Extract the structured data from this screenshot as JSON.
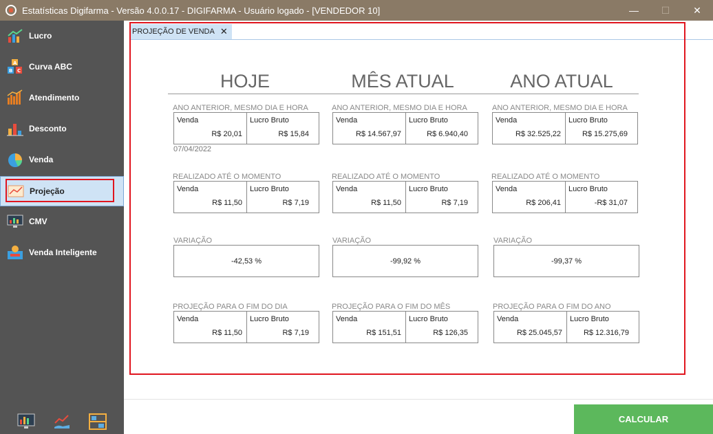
{
  "window": {
    "title": "Estatísticas Digifarma - Versão 4.0.0.17 - DIGIFARMA -  Usuário logado - [VENDEDOR 10]",
    "minimize": "—",
    "maximize": "☐",
    "close": "✕"
  },
  "sidebar": {
    "items": [
      {
        "label": "Lucro",
        "icon": "profit-chart-icon"
      },
      {
        "label": "Curva ABC",
        "icon": "abc-blocks-icon"
      },
      {
        "label": "Atendimento",
        "icon": "bar-chart-icon"
      },
      {
        "label": "Desconto",
        "icon": "discount-chart-icon"
      },
      {
        "label": "Venda",
        "icon": "pie-chart-icon"
      },
      {
        "label": "Projeção",
        "icon": "projection-chart-icon"
      },
      {
        "label": "CMV",
        "icon": "monitor-chart-icon"
      },
      {
        "label": "Venda Inteligente",
        "icon": "smart-sale-icon"
      }
    ],
    "active_index": 5
  },
  "tab": {
    "label": "PROJEÇÃO DE VENDA",
    "close": "✕"
  },
  "columns": [
    {
      "title": "HOJE",
      "prev_label": "ANO ANTERIOR, MESMO DIA E HORA",
      "prev": {
        "venda_label": "Venda",
        "venda": "R$ 20,01",
        "lucro_label": "Lucro Bruto",
        "lucro": "R$ 15,84"
      },
      "date": "07/04/2022",
      "real_label": "REALIZADO ATÉ O MOMENTO",
      "real": {
        "venda_label": "Venda",
        "venda": "R$ 11,50",
        "lucro_label": "Lucro Bruto",
        "lucro": "R$ 7,19"
      },
      "var_label": "VARIAÇÃO",
      "variacao": "-42,53 %",
      "proj_label": "PROJEÇÃO PARA O FIM DO DIA",
      "proj": {
        "venda_label": "Venda",
        "venda": "R$ 11,50",
        "lucro_label": "Lucro Bruto",
        "lucro": "R$ 7,19"
      }
    },
    {
      "title": "MÊS ATUAL",
      "prev_label": "ANO ANTERIOR, MESMO DIA E HORA",
      "prev": {
        "venda_label": "Venda",
        "venda": "R$ 14.567,97",
        "lucro_label": "Lucro Bruto",
        "lucro": "R$ 6.940,40"
      },
      "real_label": "REALIZADO ATÉ O MOMENTO",
      "real": {
        "venda_label": "Venda",
        "venda": "R$ 11,50",
        "lucro_label": "Lucro Bruto",
        "lucro": "R$ 7,19"
      },
      "var_label": "VARIAÇÃO",
      "variacao": "-99,92 %",
      "proj_label": "PROJEÇÃO PARA O FIM DO MÊS",
      "proj": {
        "venda_label": "Venda",
        "venda": "R$ 151,51",
        "lucro_label": "Lucro Bruto",
        "lucro": "R$ 126,35"
      }
    },
    {
      "title": "ANO ATUAL",
      "prev_label": "ANO ANTERIOR, MESMO DIA E HORA",
      "prev": {
        "venda_label": "Venda",
        "venda": "R$ 32.525,22",
        "lucro_label": "Lucro Bruto",
        "lucro": "R$ 15.275,69"
      },
      "real_label": "REALIZADO ATÉ O MOMENTO",
      "real": {
        "venda_label": "Venda",
        "venda": "R$ 206,41",
        "lucro_label": "Lucro Bruto",
        "lucro": "-R$ 31,07"
      },
      "var_label": "VARIAÇÃO",
      "variacao": "-99,37 %",
      "proj_label": "PROJEÇÃO PARA O FIM DO ANO",
      "proj": {
        "venda_label": "Venda",
        "venda": "R$ 25.045,57",
        "lucro_label": "Lucro Bruto",
        "lucro": "R$ 12.316,79"
      }
    }
  ],
  "footer": {
    "calc_label": "CALCULAR"
  },
  "colors": {
    "titlebar": "#8a7a66",
    "sidebar": "#545454",
    "active": "#cfe3f5",
    "highlight": "#e0141e",
    "button": "#5cb85c"
  }
}
